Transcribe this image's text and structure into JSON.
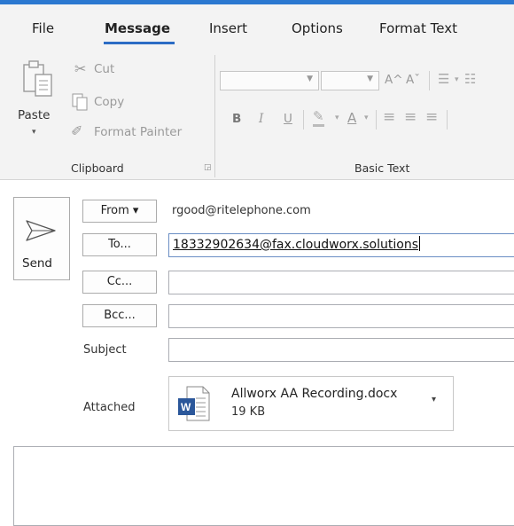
{
  "colors": {
    "accent": "#2b78d0",
    "ribbon_bg": "#f3f3f3",
    "word_blue": "#2b579a"
  },
  "tabs": [
    {
      "label": "File",
      "active": false
    },
    {
      "label": "Message",
      "active": true
    },
    {
      "label": "Insert",
      "active": false
    },
    {
      "label": "Options",
      "active": false
    },
    {
      "label": "Format Text",
      "active": false
    }
  ],
  "clipboard": {
    "paste_label": "Paste",
    "cut_label": "Cut",
    "copy_label": "Copy",
    "format_painter_label": "Format Painter",
    "group_label": "Clipboard"
  },
  "basic_text": {
    "group_label": "Basic Text",
    "font_name": "",
    "font_size": "",
    "grow_label": "A^",
    "shrink_label": "Aˇ",
    "bold": "B",
    "italic": "I",
    "underline": "U",
    "font_color": "A"
  },
  "compose": {
    "send_label": "Send",
    "from_label": "From ▾",
    "from_value": "rgood@ritelephone.com",
    "to_label": "To...",
    "to_value": "18332902634@fax.cloudworx.solutions",
    "cc_label": "Cc...",
    "cc_value": "",
    "bcc_label": "Bcc...",
    "bcc_value": "",
    "subject_label": "Subject",
    "subject_value": "",
    "attached_label": "Attached",
    "attachment": {
      "filename": "Allworx AA Recording.docx",
      "size": "19 KB",
      "icon": "word-document-icon"
    }
  }
}
